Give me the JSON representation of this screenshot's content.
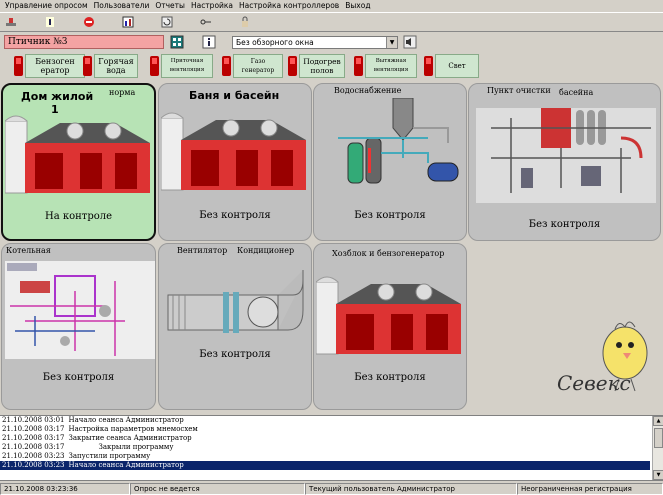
{
  "menu": [
    "Управление опросом",
    "Пользователи",
    "Отчеты",
    "Настройка",
    "Настройка контроллеров",
    "Выход"
  ],
  "toolbar": {
    "icons": [
      "tool-icon",
      "info-icon",
      "stop-icon",
      "chart-icon",
      "refresh-icon",
      "key-icon",
      "lock-icon"
    ]
  },
  "header": {
    "bird_house": "Птичник №3",
    "view_select": "Без обзорного окна"
  },
  "controls": [
    {
      "label": "Бензоген ератор",
      "color": "#cc0000"
    },
    {
      "label": "Горячая вода",
      "color": "#cc0000"
    },
    {
      "label": "Приточная вентиляция",
      "color": "#cc0000"
    },
    {
      "label": "Газо генератор",
      "color": "#cc0000"
    },
    {
      "label": "Подогрев полов",
      "color": "#cc0000"
    },
    {
      "label": "Вытяжная вентиляция",
      "color": "#cc0000"
    },
    {
      "label": "Свет",
      "color": "#cc0000"
    }
  ],
  "tiles": [
    {
      "title": "Дом жилой",
      "subtitle": "1",
      "badge": "норма",
      "status": "На контроле"
    },
    {
      "title": "Баня и басейн",
      "status": "Без контроля"
    },
    {
      "title": "Водоснабжение",
      "status": "Без контроля"
    },
    {
      "title": "Пункт очистки",
      "badge": "басейна",
      "status": "Без контроля"
    },
    {
      "title": "Котельная",
      "status": "Без контроля"
    },
    {
      "title": "Вентилятор",
      "badge": "Кондиционер",
      "status": "Без контроля"
    },
    {
      "title": "Хозблок и бензогенератор",
      "status": "Без контроля"
    }
  ],
  "logo": {
    "text": "Севекс"
  },
  "log": [
    {
      "ts": "21.10.2008 03:01",
      "msg": "Начало сеанса Администратор"
    },
    {
      "ts": "21.10.2008 03:17",
      "msg": "Настройка параметров мнемосхем"
    },
    {
      "ts": "21.10.2008 03:17",
      "msg": "Закрытие сеанса Администратор"
    },
    {
      "ts": "21.10.2008 03:17",
      "msg": "Закрыли программу"
    },
    {
      "ts": "21.10.2008 03:23",
      "msg": "Запустили программу"
    },
    {
      "ts": "21.10.2008 03:23",
      "msg": "Начало сеанса Администратор"
    }
  ],
  "statusbar": {
    "datetime": "21.10.2008 03:23:36",
    "poll": "Опрос не ведется",
    "user": "Текущий пользователь  Администратор",
    "reg": "Неограниченная регистрация"
  }
}
